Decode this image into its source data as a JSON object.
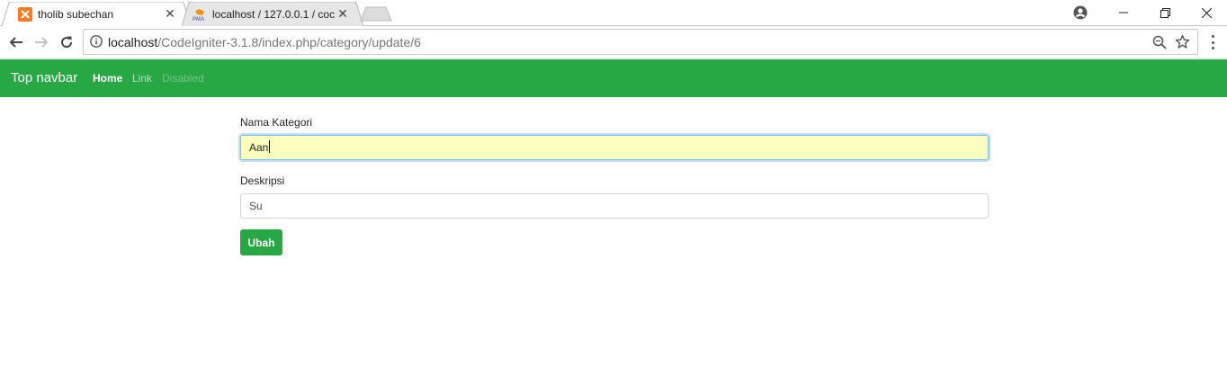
{
  "browser": {
    "tabs": [
      {
        "title": "tholib subechan",
        "favicon": "xampp-icon",
        "active": true
      },
      {
        "title": "localhost / 127.0.0.1 / coc",
        "favicon": "phpmyadmin-icon",
        "active": false
      }
    ],
    "address": {
      "host": "localhost",
      "path": "/CodeIgniter-3.1.8/index.php/category/update/6"
    }
  },
  "navbar": {
    "brand": "Top navbar",
    "links": [
      {
        "label": "Home",
        "state": "active"
      },
      {
        "label": "Link",
        "state": "normal"
      },
      {
        "label": "Disabled",
        "state": "disabled"
      }
    ],
    "color": "#28a745"
  },
  "form": {
    "nama_kategori_label": "Nama Kategori",
    "nama_kategori_value": "Aan",
    "deskripsi_label": "Deskripsi",
    "deskripsi_value": "Su",
    "submit_label": "Ubah"
  }
}
